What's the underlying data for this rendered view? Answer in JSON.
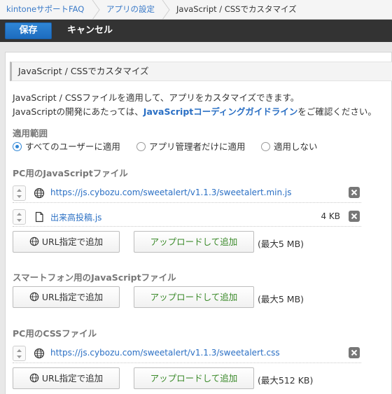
{
  "breadcrumb": {
    "items": [
      "kintoneサポートFAQ",
      "アプリの設定",
      "JavaScript / CSSでカスタマイズ"
    ]
  },
  "toolbar": {
    "save_label": "保存",
    "cancel_label": "キャンセル"
  },
  "heading": "JavaScript / CSSでカスタマイズ",
  "description": {
    "line1": "JavaScript / CSSファイルを適用して、アプリをカスタマイズできます。",
    "line2_prefix": "JavaScriptの開発にあたっては、",
    "line2_link": "JavaScriptコーディングガイドライン",
    "line2_suffix": "をご確認ください。"
  },
  "scope": {
    "label": "適用範囲",
    "options": [
      "すべてのユーザーに適用",
      "アプリ管理者だけに適用",
      "適用しない"
    ],
    "selected": "すべてのユーザーに適用"
  },
  "pc_js": {
    "label": "PC用のJavaScriptファイル",
    "files": [
      {
        "type": "url",
        "name": "https://js.cybozu.com/sweetalert/v1.1.3/sweetalert.min.js",
        "size": ""
      },
      {
        "type": "file",
        "name": "出来高投稿.js",
        "size": "4 KB"
      }
    ],
    "url_button": "URL指定で追加",
    "upload_button": "アップロードして追加",
    "max_size": "(最大5 MB)"
  },
  "sp_js": {
    "label": "スマートフォン用のJavaScriptファイル",
    "url_button": "URL指定で追加",
    "upload_button": "アップロードして追加",
    "max_size": "(最大5 MB)"
  },
  "pc_css": {
    "label": "PC用のCSSファイル",
    "files": [
      {
        "type": "url",
        "name": "https://js.cybozu.com/sweetalert/v1.1.3/sweetalert.css",
        "size": ""
      }
    ],
    "url_button": "URL指定で追加",
    "upload_button": "アップロードして追加",
    "max_size": "(最大512 KB)"
  },
  "colors": {
    "accent": "#2f86d6",
    "link": "#2a6fc4",
    "upload_text": "#3b8a2a",
    "toolbar_bg": "#333333"
  },
  "icons": {
    "url_file": "globe-icon",
    "local_file": "document-icon",
    "delete": "close-icon",
    "sort": "sort-handle-icon"
  }
}
